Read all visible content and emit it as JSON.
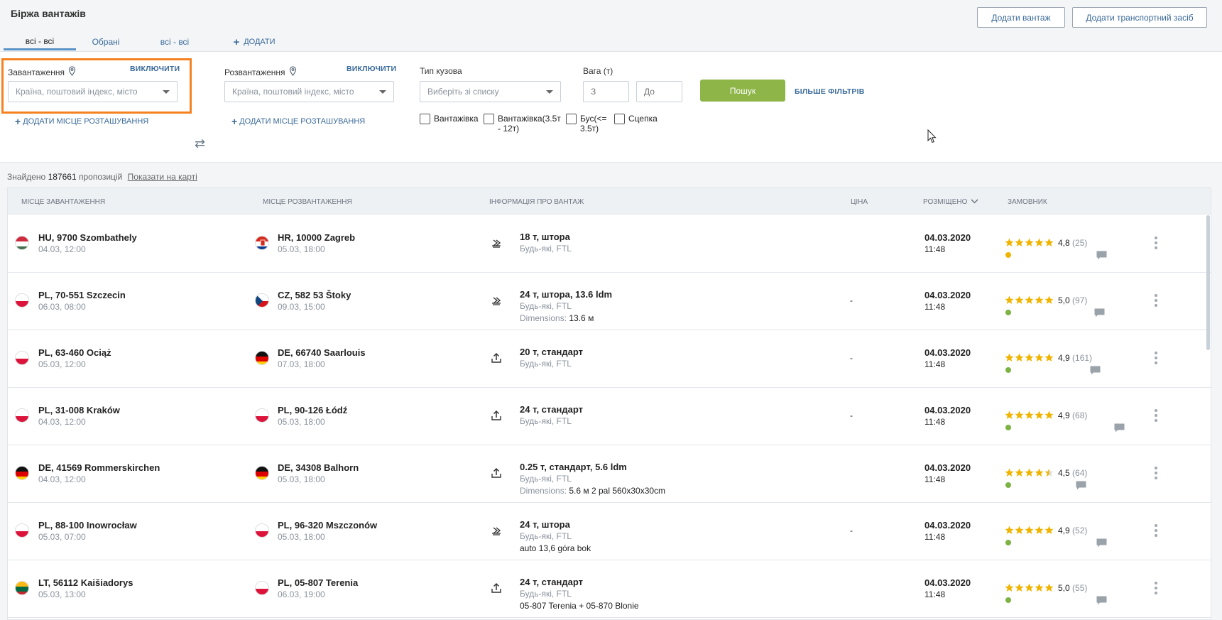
{
  "header": {
    "title": "Біржа вантажів",
    "add_cargo": "Додати вантаж",
    "add_vehicle": "Додати транспортний засіб"
  },
  "tabs": [
    {
      "label": "всі - всі",
      "active": true
    },
    {
      "label": "Обрані",
      "active": false
    },
    {
      "label": "всі - всі",
      "active": false
    },
    {
      "label": "ДОДАТИ",
      "active": false
    }
  ],
  "filters": {
    "loading": {
      "label": "Завантаження",
      "exclude": "ВИКЛЮЧИТИ",
      "placeholder": "Країна, поштовий індекс, місто",
      "add_location": "ДОДАТИ МІСЦЕ РОЗТАШУВАННЯ"
    },
    "unloading": {
      "label": "Розвантаження",
      "exclude": "ВИКЛЮЧИТИ",
      "placeholder": "Країна, поштовий індекс, місто",
      "add_location": "ДОДАТИ МІСЦЕ РОЗТАШУВАННЯ"
    },
    "body_type": {
      "label": "Тип кузова",
      "placeholder": "Виберіть зі списку"
    },
    "weight": {
      "label": "Вага (т)",
      "from_placeholder": "З",
      "to_placeholder": "До"
    },
    "search": "Пошук",
    "more_filters": "БІЛЬШЕ ФІЛЬТРІВ",
    "vehicle_types": [
      {
        "line1": "Вантажівка",
        "line2": ""
      },
      {
        "line1": "Вантажівка(3.5т",
        "line2": "- 12т)"
      },
      {
        "line1": "Бус(<=",
        "line2": "3.5т)"
      },
      {
        "line1": "Сцепка",
        "line2": ""
      }
    ]
  },
  "results": {
    "found_prefix": "Знайдено",
    "found_count": "187661",
    "found_suffix": "пропозицій",
    "show_on_map": "Показати на карті"
  },
  "columns": {
    "loading": "МІСЦЕ ЗАВАНТАЖЕННЯ",
    "unloading": "МІСЦЕ РОЗВАНТАЖЕННЯ",
    "cargo": "ІНФОРМАЦІЯ ПРО ВАНТАЖ",
    "price": "ЦІНА",
    "posted": "РОЗМІЩЕНО",
    "customer": "ЗАМОВНИК"
  },
  "rows": [
    {
      "from_flag": "hu",
      "from": "HU, 9700 Szombathely",
      "from_date": "04.03, 12:00",
      "to_flag": "hr",
      "to": "HR, 10000 Zagreb",
      "to_date": "05.03, 18:00",
      "cargo_icon": "side-load-icon",
      "cargo": "18 т, штора",
      "cargo_sub": "Будь-які, FTL",
      "extra_key": "",
      "extra_val": "",
      "price": "",
      "posted_date": "04.03.2020",
      "posted_time": "11:48",
      "stars": 5,
      "rating": "4,8",
      "reviews": "(25)",
      "status_color": "#f0b400"
    },
    {
      "from_flag": "pl",
      "from": "PL, 70-551 Szczecin",
      "from_date": "06.03, 08:00",
      "to_flag": "cz",
      "to": "CZ, 582 53 Štoky",
      "to_date": "09.03, 15:00",
      "cargo_icon": "side-load-icon",
      "cargo": "24 т, штора, 13.6 ldm",
      "cargo_sub": "Будь-які, FTL",
      "extra_key": "Dimensions:",
      "extra_val": "13.6 м",
      "price": "-",
      "posted_date": "04.03.2020",
      "posted_time": "11:48",
      "stars": 5,
      "rating": "5,0",
      "reviews": "(97)",
      "status_color": "#7cb342"
    },
    {
      "from_flag": "pl",
      "from": "PL, 63-460 Ociąż",
      "from_date": "05.03, 12:00",
      "to_flag": "de",
      "to": "DE, 66740 Saarlouis",
      "to_date": "07.03, 18:00",
      "cargo_icon": "top-load-icon",
      "cargo": "20 т, стандарт",
      "cargo_sub": "Будь-які, FTL",
      "extra_key": "",
      "extra_val": "",
      "price": "-",
      "posted_date": "04.03.2020",
      "posted_time": "11:48",
      "stars": 5,
      "rating": "4,9",
      "reviews": "(161)",
      "status_color": "#7cb342"
    },
    {
      "from_flag": "pl",
      "from": "PL, 31-008 Kraków",
      "from_date": "04.03, 12:00",
      "to_flag": "pl",
      "to": "PL, 90-126 Łódź",
      "to_date": "05.03, 18:00",
      "cargo_icon": "top-load-icon",
      "cargo": "24 т, стандарт",
      "cargo_sub": "Будь-які, FTL",
      "extra_key": "",
      "extra_val": "",
      "price": "-",
      "posted_date": "04.03.2020",
      "posted_time": "11:48",
      "stars": 5,
      "rating": "4,9",
      "reviews": "(68)",
      "status_color": "#7cb342"
    },
    {
      "from_flag": "de",
      "from": "DE, 41569 Rommerskirchen",
      "from_date": "04.03, 12:00",
      "to_flag": "de",
      "to": "DE, 34308 Balhorn",
      "to_date": "05.03, 18:00",
      "cargo_icon": "top-load-icon",
      "cargo": "0.25 т, стандарт, 5.6 ldm",
      "cargo_sub": "Будь-які, FTL",
      "extra_key": "Dimensions:",
      "extra_val": "5.6 м 2 pal 560x30x30cm",
      "price": "",
      "posted_date": "04.03.2020",
      "posted_time": "11:48",
      "stars": 4.5,
      "rating": "4,5",
      "reviews": "(64)",
      "status_color": "#7cb342"
    },
    {
      "from_flag": "pl",
      "from": "PL, 88-100 Inowrocław",
      "from_date": "05.03, 07:00",
      "to_flag": "pl",
      "to": "PL, 96-320 Mszczonów",
      "to_date": "05.03, 18:00",
      "cargo_icon": "side-load-icon",
      "cargo": "24 т, штора",
      "cargo_sub": "Будь-які, FTL",
      "extra_key": "",
      "extra_val": "auto 13,6 góra bok",
      "price": "-",
      "posted_date": "04.03.2020",
      "posted_time": "11:48",
      "stars": 5,
      "rating": "4,9",
      "reviews": "(52)",
      "status_color": "#7cb342"
    },
    {
      "from_flag": "lt",
      "from": "LT, 56112 Kaišiadorys",
      "from_date": "05.03, 13:00",
      "to_flag": "pl",
      "to": "PL, 05-807 Terenia",
      "to_date": "06.03, 19:00",
      "cargo_icon": "top-load-icon",
      "cargo": "24 т, стандарт",
      "cargo_sub": "Будь-які, FTL",
      "extra_key": "",
      "extra_val": "05-807 Terenia + 05-870 Blonie",
      "price": "",
      "posted_date": "04.03.2020",
      "posted_time": "11:48",
      "stars": 5,
      "rating": "5,0",
      "reviews": "(55)",
      "status_color": "#7cb342"
    }
  ],
  "colors": {
    "accent": "#3a6a9a",
    "search_button": "#8db548",
    "highlight": "#f58220",
    "star": "#f0b400"
  }
}
